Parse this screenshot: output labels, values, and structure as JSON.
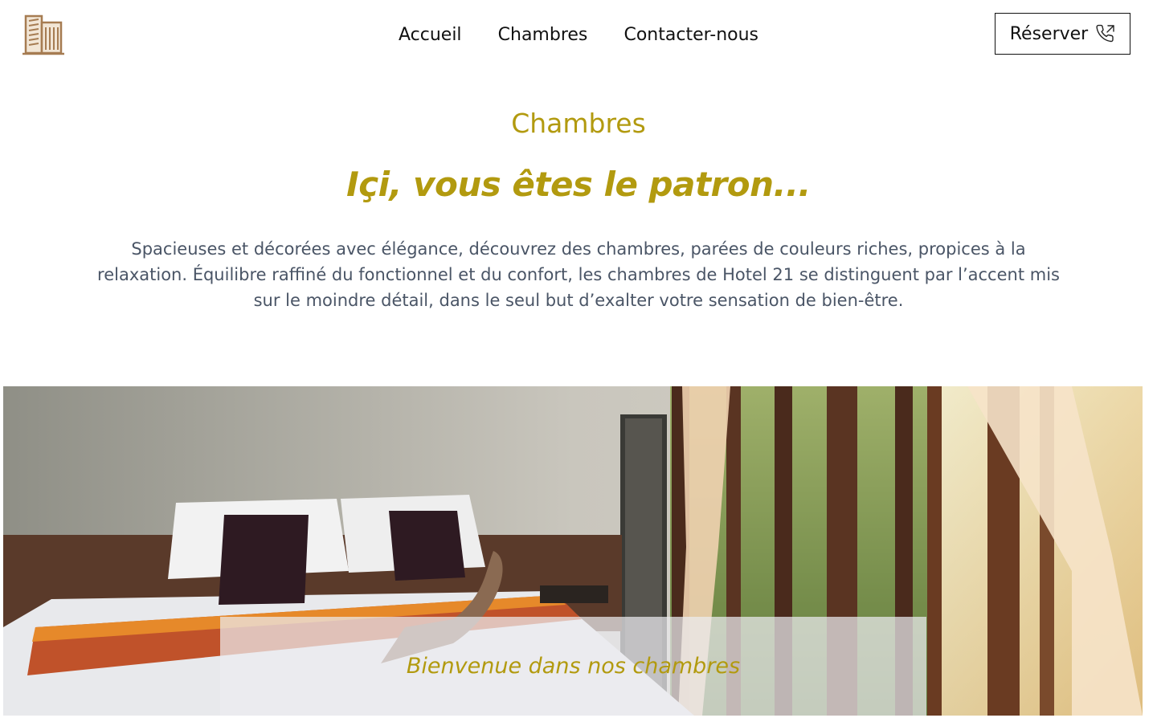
{
  "header": {
    "logo_icon": "hotel-building-icon",
    "nav": [
      {
        "label": "Accueil"
      },
      {
        "label": "Chambres"
      },
      {
        "label": "Contacter-nous"
      }
    ],
    "reserve_label": "Réserver",
    "reserve_icon": "phone-outgoing-icon"
  },
  "main": {
    "section_title": "Chambres",
    "tagline": "Içi, vous êtes le patron...",
    "description": "Spacieuses et décorées avec élégance, découvrez des chambres, parées de couleurs riches, propices à la relaxation. Équilibre raffiné du fonctionnel et du confort, les chambres de Hotel 21 se distinguent par l’accent mis sur le moindre détail, dans le seul but d’exalter votre sensation de bien-être."
  },
  "hero": {
    "caption": "Bienvenue dans nos chambres"
  },
  "colors": {
    "accent": "#b29a0f",
    "text": "#4a5566",
    "logo": "#a67c52"
  }
}
